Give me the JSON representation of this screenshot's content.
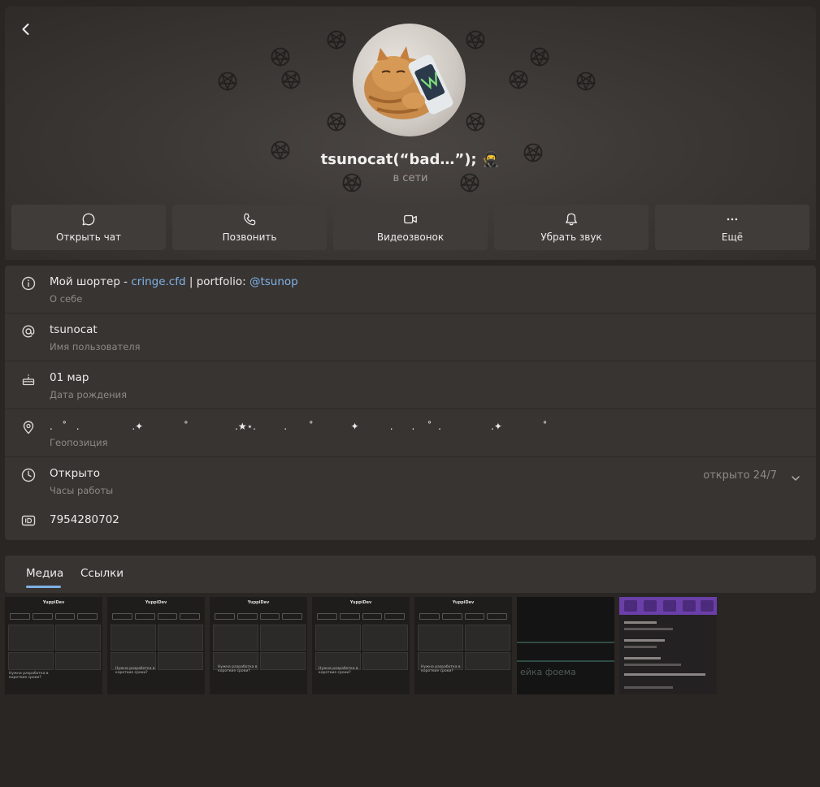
{
  "profile": {
    "name": "tsunocat(“bad…”); 🥷",
    "status": "в сети"
  },
  "actions": [
    {
      "label": "Открыть чат",
      "icon": "chat-bubble-icon"
    },
    {
      "label": "Позвонить",
      "icon": "phone-icon"
    },
    {
      "label": "Видеозвонок",
      "icon": "video-camera-icon"
    },
    {
      "label": "Убрать звук",
      "icon": "bell-icon"
    },
    {
      "label": "Ещё",
      "icon": "more-dots-icon"
    }
  ],
  "info": {
    "bio": {
      "prefix": "Мой шортер - ",
      "link1": "cringe.cfd",
      "middle": " | portfolio: ",
      "link2": "@tsunop",
      "label": "О себе"
    },
    "username": {
      "value": "tsunocat",
      "label": "Имя пользователя"
    },
    "birthday": {
      "value": "01 мар",
      "label": "Дата рождения"
    },
    "location": {
      "value": ".   ˚   .                 .✦             ˚               .★⋆.         .       ˚            ✦          .      .    ˚  .                .✦             ˚",
      "label": "Геопозиция"
    },
    "hours": {
      "value": "Открыто",
      "label": "Часы работы",
      "note": "открыто 24/7"
    },
    "id": {
      "value": "7954280702"
    }
  },
  "tabs": [
    {
      "label": "Медиа",
      "active": true
    },
    {
      "label": "Ссылки",
      "active": false
    }
  ],
  "media": {
    "thumb_title": "YuppiDev",
    "thumb_headline": "Нужна разработка в короткие сроки?",
    "thumb_video_caption": "ейка фоема"
  },
  "colors": {
    "accent": "#7fb2e6",
    "online_green": "#5fcf5f",
    "card_bg": "#383432"
  }
}
